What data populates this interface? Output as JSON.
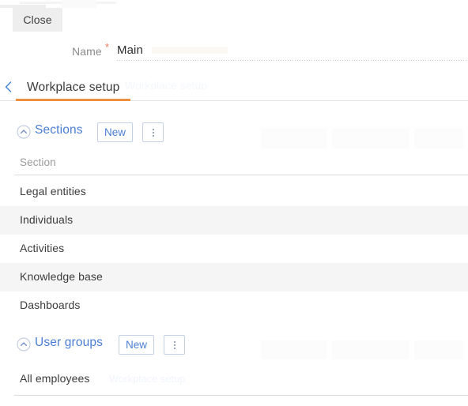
{
  "toolbar": {
    "close_label": "Close"
  },
  "form": {
    "name_label": "Name",
    "required_marker": "*",
    "name_value": "Main",
    "name_placeholder": ""
  },
  "tabs": {
    "back_icon": "chevron-left-icon",
    "active": "Workplace setup",
    "items": [
      {
        "label": "Workplace setup",
        "active": true
      }
    ]
  },
  "sections_panel": {
    "title": "Sections",
    "collapse_icon": "chevron-up-circle-icon",
    "new_label": "New",
    "more_icon": "kebab-menu-icon",
    "column_header": "Section",
    "rows": [
      {
        "section": "Legal entities"
      },
      {
        "section": "Individuals"
      },
      {
        "section": "Activities"
      },
      {
        "section": "Knowledge base"
      },
      {
        "section": "Dashboards"
      }
    ]
  },
  "user_groups_panel": {
    "title": "User groups",
    "collapse_icon": "chevron-up-circle-icon",
    "new_label": "New",
    "more_icon": "kebab-menu-icon",
    "rows": [
      {
        "group": "All employees"
      }
    ]
  },
  "colors": {
    "accent_orange": "#ef8f40",
    "link_blue": "#4a7fd4",
    "required_red": "#f07b5a",
    "row_stripe": "#f5f5f5",
    "rule": "#dcdcdc"
  }
}
